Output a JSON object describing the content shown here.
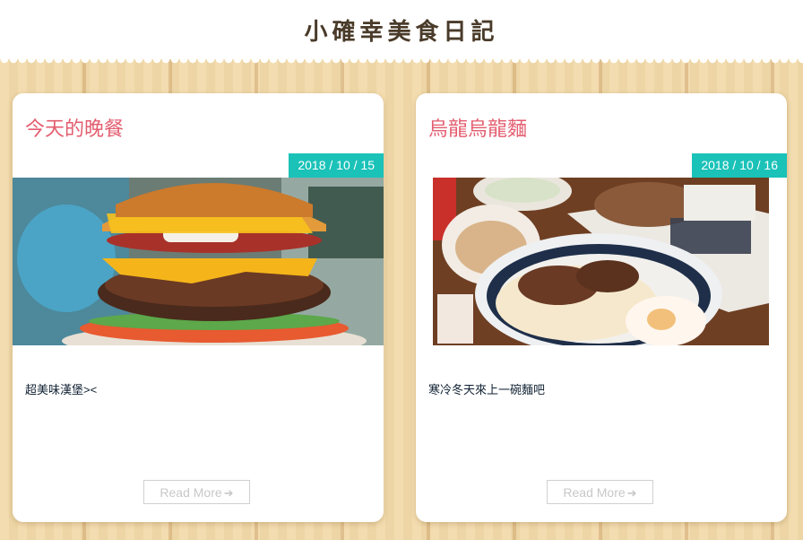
{
  "site": {
    "title": "小確幸美食日記"
  },
  "posts": [
    {
      "title": "今天的晚餐",
      "date": "2018 / 10 / 15",
      "excerpt": "超美味漢堡><",
      "read_more": "Read More",
      "image": "burger-photo"
    },
    {
      "title": "烏龍烏龍麵",
      "date": "2018 / 10 / 16",
      "excerpt": "寒冷冬天來上一碗麵吧",
      "read_more": "Read More",
      "image": "udon-photo"
    }
  ],
  "icons": {
    "read_more": "arrow-right-icon"
  },
  "colors": {
    "title": "#e35d6f",
    "badge": "#1ac2b8",
    "wood": "#f2d9a8"
  }
}
